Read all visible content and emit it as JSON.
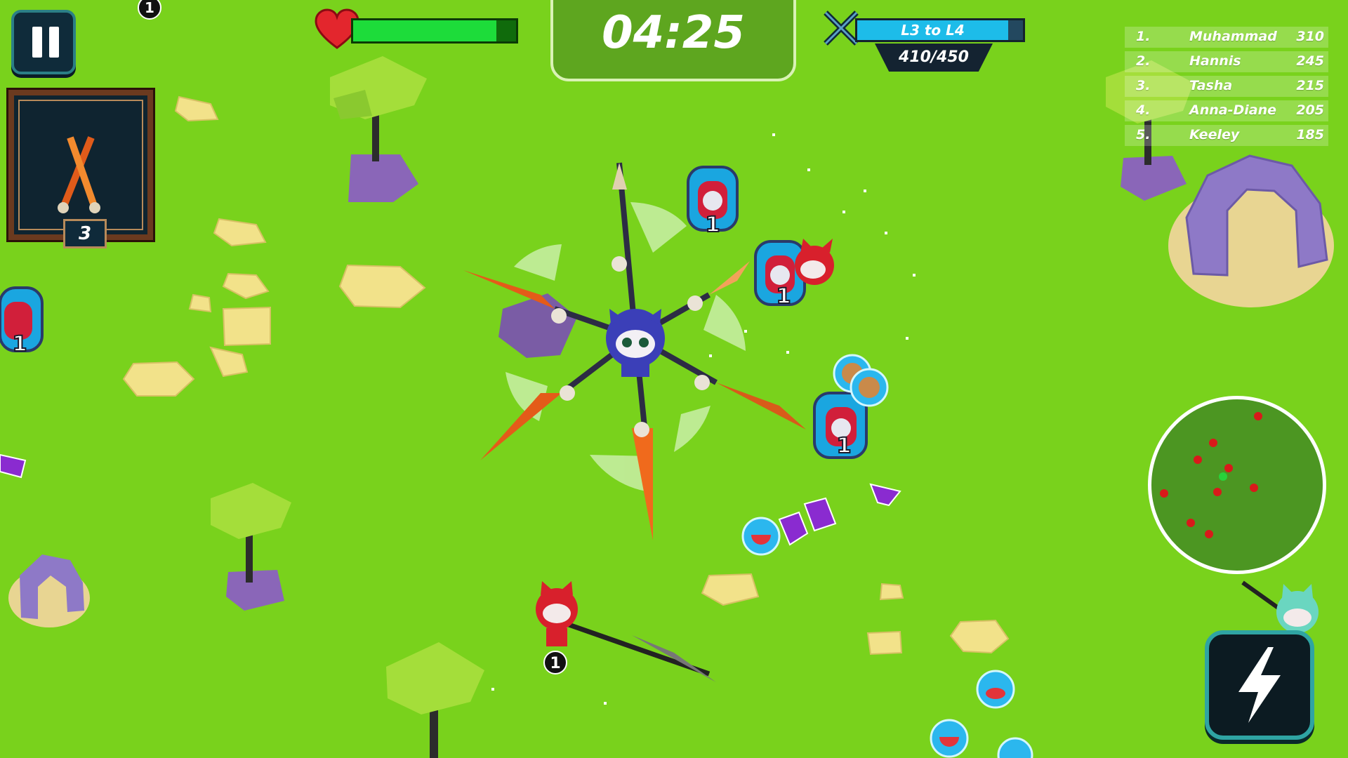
{
  "hud": {
    "timer": "04:25",
    "health_fraction": 0.88,
    "xp": {
      "label": "L3 to L4",
      "count": "410/450",
      "fraction": 0.911
    },
    "weapon_level": "3",
    "top_badge": "1"
  },
  "leaderboard": [
    {
      "rank": "1.",
      "name": "Muhammad",
      "score": "310"
    },
    {
      "rank": "2.",
      "name": "Hannis",
      "score": "245"
    },
    {
      "rank": "3.",
      "name": "Tasha",
      "score": "215"
    },
    {
      "rank": "4.",
      "name": "Anna-Diane",
      "score": "205"
    },
    {
      "rank": "5.",
      "name": "Keeley",
      "score": "185"
    }
  ],
  "world": {
    "backpack_count": "1",
    "enemy_count": "1"
  },
  "colors": {
    "ground": "#79d21c",
    "health": "#1ddc3a",
    "xp": "#1dbce9",
    "player": "#3b3fb8",
    "enemy": "#d8202c"
  }
}
